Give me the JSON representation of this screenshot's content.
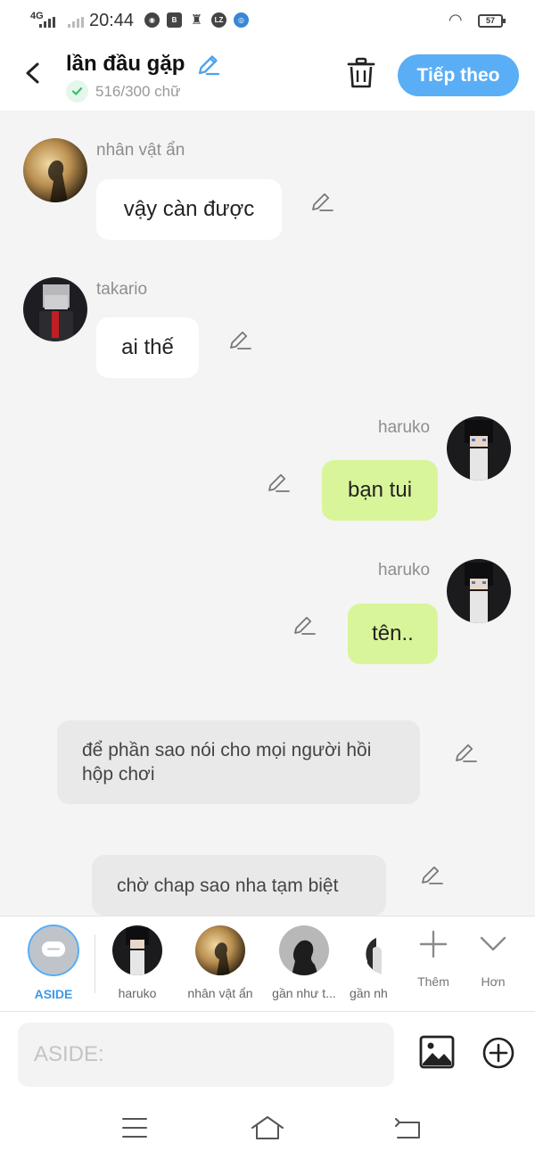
{
  "status_bar": {
    "network": "4G",
    "time": "20:44",
    "notification_icons": [
      "globe-icon",
      "bao-moi-icon",
      "statue-icon",
      "laz-icon",
      "radio-icon"
    ],
    "battery": "57"
  },
  "header": {
    "title": "lần đầu gặp",
    "word_count": "516/300 chữ",
    "next_label": "Tiếp theo"
  },
  "messages": [
    {
      "speaker": "nhân vật ẩn",
      "text": "vậy càn được",
      "side": "left"
    },
    {
      "speaker": "takario",
      "text": "ai thế",
      "side": "left"
    },
    {
      "speaker": "haruko",
      "text": "bạn tui",
      "side": "right"
    },
    {
      "speaker": "haruko",
      "text": "tên..",
      "side": "right"
    },
    {
      "speaker": "",
      "text": "để phần sao nói cho mọi người hồi hộp chơi",
      "side": "aside"
    },
    {
      "speaker": "",
      "text": "chờ chap sao nha tạm biệt",
      "side": "aside"
    }
  ],
  "characters": {
    "aside_label": "ASIDE",
    "items": [
      {
        "label": "haruko"
      },
      {
        "label": "nhân vật ẩn"
      },
      {
        "label": "gần như t..."
      },
      {
        "label": "gần nh"
      }
    ],
    "add_label": "Thêm",
    "more_label": "Hơn"
  },
  "composer": {
    "placeholder": "ASIDE:",
    "value": ""
  },
  "colors": {
    "accent": "#5aaef5",
    "own_bubble": "#d9f59a",
    "other_bubble": "#ffffff",
    "aside_bubble": "#e9e9e9",
    "check_green": "#2ec26a"
  }
}
